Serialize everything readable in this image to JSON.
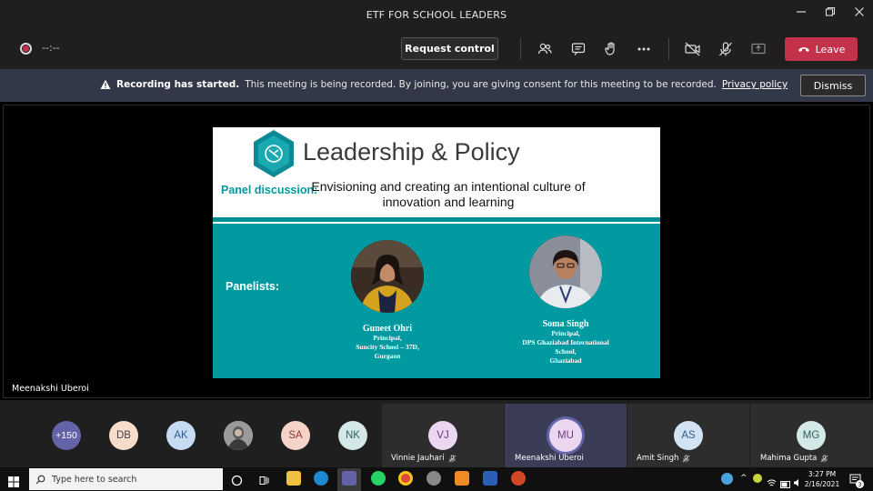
{
  "window": {
    "title": "ETF FOR SCHOOL LEADERS"
  },
  "toolbar": {
    "timer": "--:--",
    "request_control_label": "Request control",
    "leave_label": "Leave"
  },
  "banner": {
    "bold": "Recording has started.",
    "text": "This meeting is being recorded. By joining, you are giving consent for this meeting to be recorded.",
    "link": "Privacy policy",
    "dismiss_label": "Dismiss"
  },
  "stage": {
    "presenter_name": "Meenakshi Uberoi"
  },
  "slide": {
    "title": "Leadership & Policy",
    "panel_label": "Panel discussion:",
    "subtitle": "Envisioning and creating an intentional culture of innovation and learning",
    "panelists_label": "Panelists:",
    "panelists": [
      {
        "name": "Guneet Ohri",
        "line1": "Principal,",
        "line2": "Suncity School – 37D,",
        "line3": "Gurgaon"
      },
      {
        "name": "Soma Singh",
        "line1": "Principal,",
        "line2": "DPS Ghaziabad International",
        "line3": "School,",
        "line4": "Ghaziabad"
      }
    ]
  },
  "participants": {
    "more_count": "+150",
    "avatars": [
      "DB",
      "AK",
      "SA",
      "NK"
    ],
    "tiles": [
      {
        "initials": "VJ",
        "name": "Vinnie Jauhari"
      },
      {
        "initials": "MU",
        "name": "Meenakshi Uberoi"
      },
      {
        "initials": "AS",
        "name": "Amit Singh"
      },
      {
        "initials": "MG",
        "name": "Mahima Gupta"
      }
    ]
  },
  "taskbar": {
    "search_placeholder": "Type here to search",
    "time": "3:27 PM",
    "date": "2/16/2021",
    "notification_count": "3"
  },
  "colors": {
    "leave": "#c4314b",
    "banner_bg": "#333848",
    "slide_teal": "#009aa0",
    "teams_purple": "#6264a7"
  }
}
